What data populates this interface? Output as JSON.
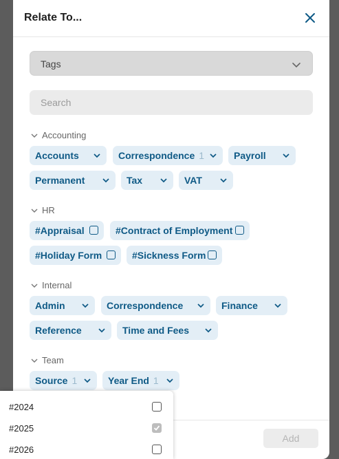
{
  "modal": {
    "title": "Relate To...",
    "tags_label": "Tags",
    "search_placeholder": "Search",
    "add_label": "Add"
  },
  "groups": {
    "accounting": {
      "title": "Accounting",
      "chips": [
        {
          "label": "Accounts"
        },
        {
          "label": "Correspondence",
          "count": "1"
        },
        {
          "label": "Payroll"
        },
        {
          "label": "Permanent"
        },
        {
          "label": "Tax"
        },
        {
          "label": "VAT"
        }
      ]
    },
    "hr": {
      "title": "HR",
      "chips": [
        {
          "label": "#Appraisal"
        },
        {
          "label": "#Contract of Employment"
        },
        {
          "label": "#Holiday Form"
        },
        {
          "label": "#Sickness Form"
        }
      ]
    },
    "internal": {
      "title": "Internal",
      "chips": [
        {
          "label": "Admin"
        },
        {
          "label": "Correspondence"
        },
        {
          "label": "Finance"
        },
        {
          "label": "Reference"
        },
        {
          "label": "Time and Fees"
        }
      ]
    },
    "team": {
      "title": "Team",
      "chips": [
        {
          "label": "Source",
          "count": "1"
        },
        {
          "label": "Year End",
          "count": "1"
        }
      ]
    }
  },
  "dropdown": {
    "items": [
      {
        "label": "#2024",
        "checked": false
      },
      {
        "label": "#2025",
        "checked": true
      },
      {
        "label": "#2026",
        "checked": false
      }
    ]
  },
  "colors": {
    "chip_bg": "#e3eef6",
    "chip_text": "#0f5a86",
    "backdrop": "#5c5c5c"
  }
}
